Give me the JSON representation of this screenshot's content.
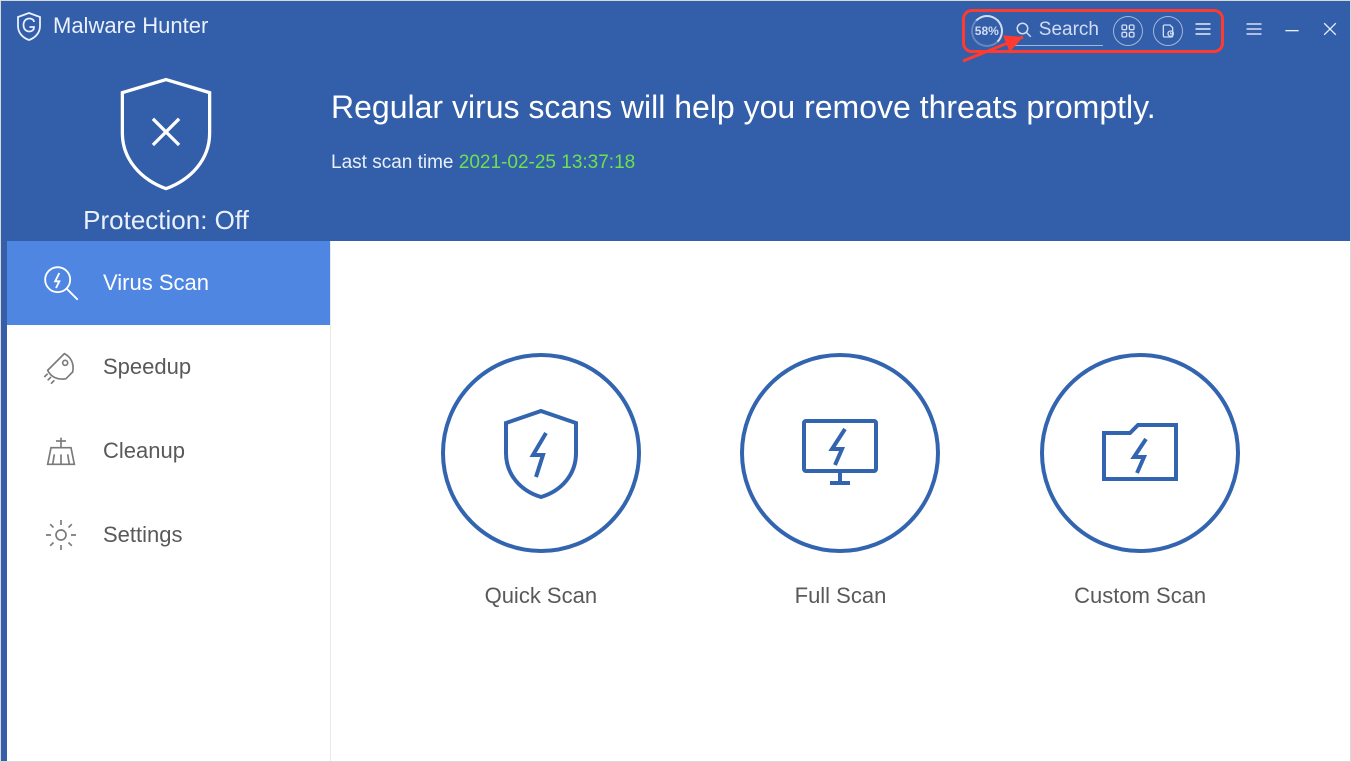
{
  "app": {
    "title": "Malware Hunter"
  },
  "header": {
    "protection_label": "Protection: Off",
    "headline": "Regular virus scans will help you remove threats promptly.",
    "lastscan_label": "Last scan time ",
    "lastscan_time": "2021-02-25 13:37:18"
  },
  "top": {
    "percent": "58%",
    "search_placeholder": "Search"
  },
  "sidebar": {
    "items": [
      {
        "label": "Virus Scan",
        "icon": "magnifier-bolt-icon"
      },
      {
        "label": "Speedup",
        "icon": "rocket-icon"
      },
      {
        "label": "Cleanup",
        "icon": "broom-icon"
      },
      {
        "label": "Settings",
        "icon": "gear-icon"
      }
    ]
  },
  "main": {
    "scans": [
      {
        "label": "Quick Scan",
        "icon": "shield-bolt-icon"
      },
      {
        "label": "Full Scan",
        "icon": "monitor-bolt-icon"
      },
      {
        "label": "Custom Scan",
        "icon": "folder-bolt-icon"
      }
    ]
  }
}
